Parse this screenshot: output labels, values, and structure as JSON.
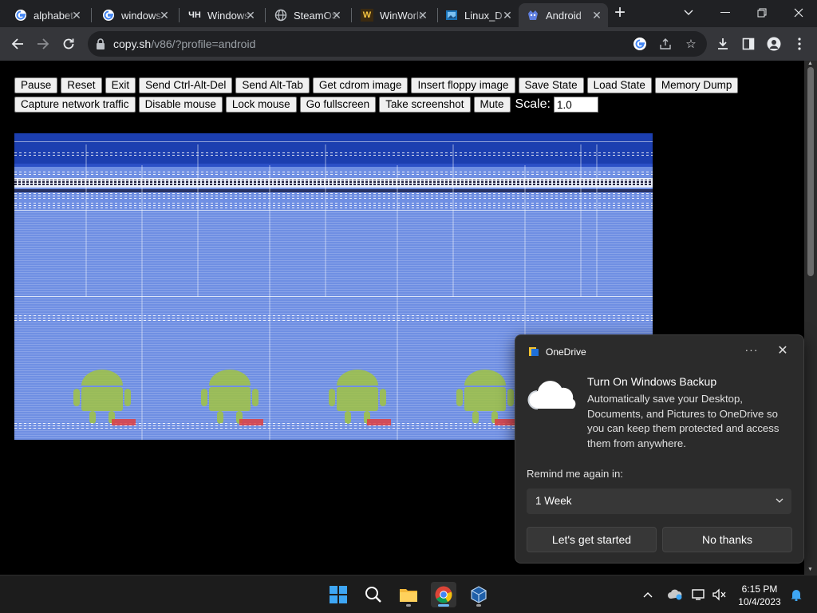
{
  "browser": {
    "tabs": [
      {
        "title": "alphabet",
        "favicon": "google-icon",
        "active": false
      },
      {
        "title": "windows",
        "favicon": "google-icon",
        "active": false
      },
      {
        "title": "Windows",
        "favicon": "wiki-icon",
        "active": false
      },
      {
        "title": "SteamOS",
        "favicon": "globe-icon",
        "active": false
      },
      {
        "title": "WinWorld",
        "favicon": "winworld-icon",
        "active": false
      },
      {
        "title": "Linux_D",
        "favicon": "image-icon",
        "active": false
      },
      {
        "title": "Android",
        "favicon": "v86-icon",
        "active": true
      }
    ],
    "new_tab": "+",
    "url_host": "copy.sh",
    "url_path": "/v86/?profile=android"
  },
  "emulator": {
    "row1": [
      "Pause",
      "Reset",
      "Exit",
      "Send Ctrl-Alt-Del",
      "Send Alt-Tab",
      "Get cdrom image",
      "Insert floppy image",
      "Save State",
      "Load State",
      "Memory Dump"
    ],
    "row2": [
      "Capture network traffic",
      "Disable mouse",
      "Lock mouse",
      "Go fullscreen",
      "Take screenshot",
      "Mute"
    ],
    "scale_label": "Scale:",
    "scale_value": "1.0"
  },
  "toast": {
    "app_name": "OneDrive",
    "more": "···",
    "close": "✕",
    "title": "Turn On Windows Backup",
    "body": "Automatically save your Desktop, Documents, and Pictures to OneDrive so you can keep them protected and access them from anywhere.",
    "remind_label": "Remind me again in:",
    "remind_value": "1 Week",
    "primary": "Let's get started",
    "secondary": "No thanks"
  },
  "taskbar": {
    "time": "6:15 PM",
    "date": "10/4/2023"
  },
  "colors": {
    "accent": "#6cb8f6",
    "emulator_screen": "#6f8fe3",
    "android_green": "#a4c639"
  }
}
